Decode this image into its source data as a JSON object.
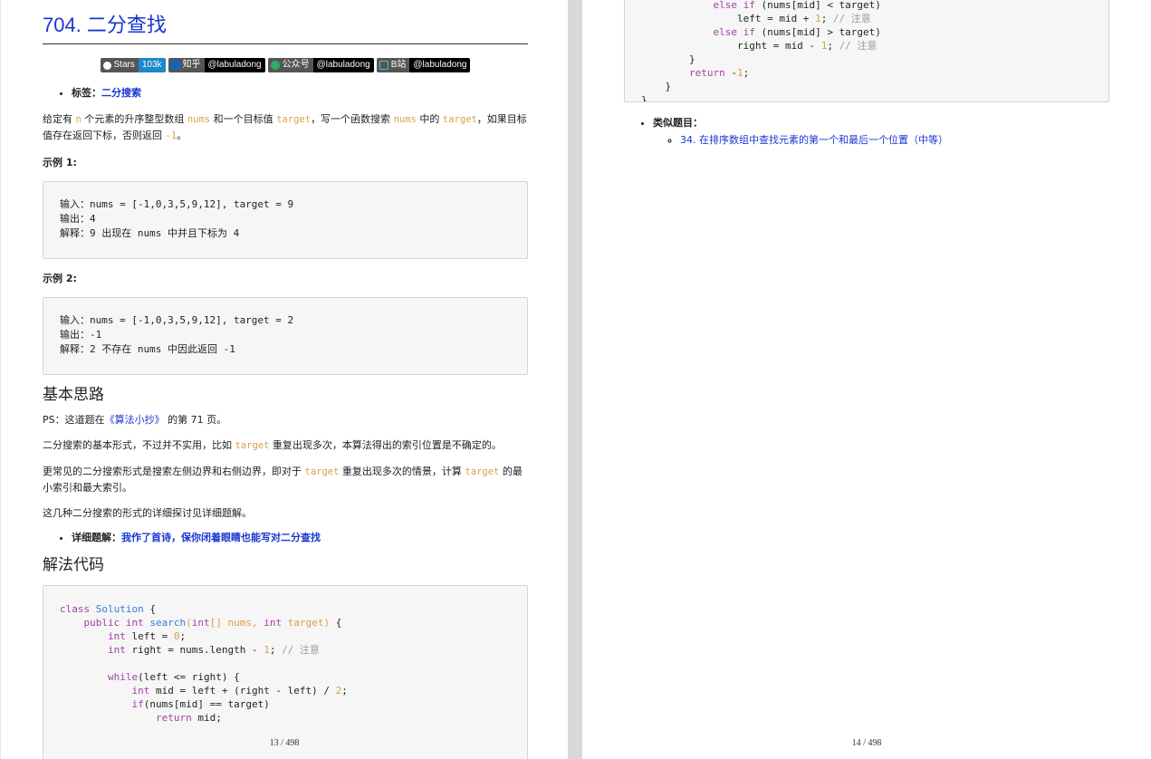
{
  "left_page": {
    "title": "704. 二分查找",
    "badges": [
      {
        "left": "Stars",
        "right": "103k",
        "icon": "github-icon",
        "color": "#1e88c8"
      },
      {
        "left": "知乎",
        "right": "@labuladong",
        "icon": "zhihu-icon",
        "color": "#0a66c2"
      },
      {
        "left": "公众号",
        "right": "@labuladong",
        "icon": "wechat-icon",
        "color": "#2aae67"
      },
      {
        "left": "B站",
        "right": "@labuladong",
        "icon": "bilibili-icon",
        "color": "#5bb3e4"
      }
    ],
    "tag_label": "标签：",
    "tag_value": "二分搜索",
    "desc": {
      "p1": "给定有 ",
      "n": "n",
      "p2": " 个元素的升序整型数组 ",
      "nums": "nums",
      "p3": " 和一个目标值 ",
      "target": "target",
      "p4": "，写一个函数搜索 ",
      "nums2": "nums",
      "p5": " 中的 ",
      "target2": "target",
      "p6": "，如果目标值存在返回下标，否则返回 ",
      "neg1": "-1",
      "p7": "。"
    },
    "example1_label": "示例 1:",
    "example1": "输入：nums = [-1,0,3,5,9,12], target = 9\n输出：4\n解释：9 出现在 nums 中并且下标为 4",
    "example2_label": "示例 2:",
    "example2": "输入：nums = [-1,0,3,5,9,12], target = 2\n输出：-1\n解释：2 不存在 nums 中因此返回 -1",
    "section1": "基本思路",
    "ps": {
      "a": "PS：这道题在",
      "book": "《算法小抄》",
      "b": " 的第 71 页。"
    },
    "para1": {
      "a": "二分搜索的基本形式，不过并不实用，比如 ",
      "t": "target",
      "b": " 重复出现多次，本算法得出的索引位置是不确定的。"
    },
    "para2": {
      "a": "更常见的二分搜索形式是搜索左侧边界和右侧边界，即对于 ",
      "t": "target",
      "b": " 重复出现多次的情景，计算 ",
      "t2": "target",
      "c": " 的最小索引和最大索引。"
    },
    "para3": "这几种二分搜索的形式的详细探讨见详细题解。",
    "detail_label": "详细题解：",
    "detail_link": "我作了首诗，保你闭着眼睛也能写对二分查找",
    "section2": "解法代码",
    "page_number": "13 / 498"
  },
  "right_page": {
    "similar_label": "类似题目：",
    "similar_link": "34. 在排序数组中查找元素的第一个和最后一个位置（中等）",
    "page_number": "14 / 498"
  }
}
